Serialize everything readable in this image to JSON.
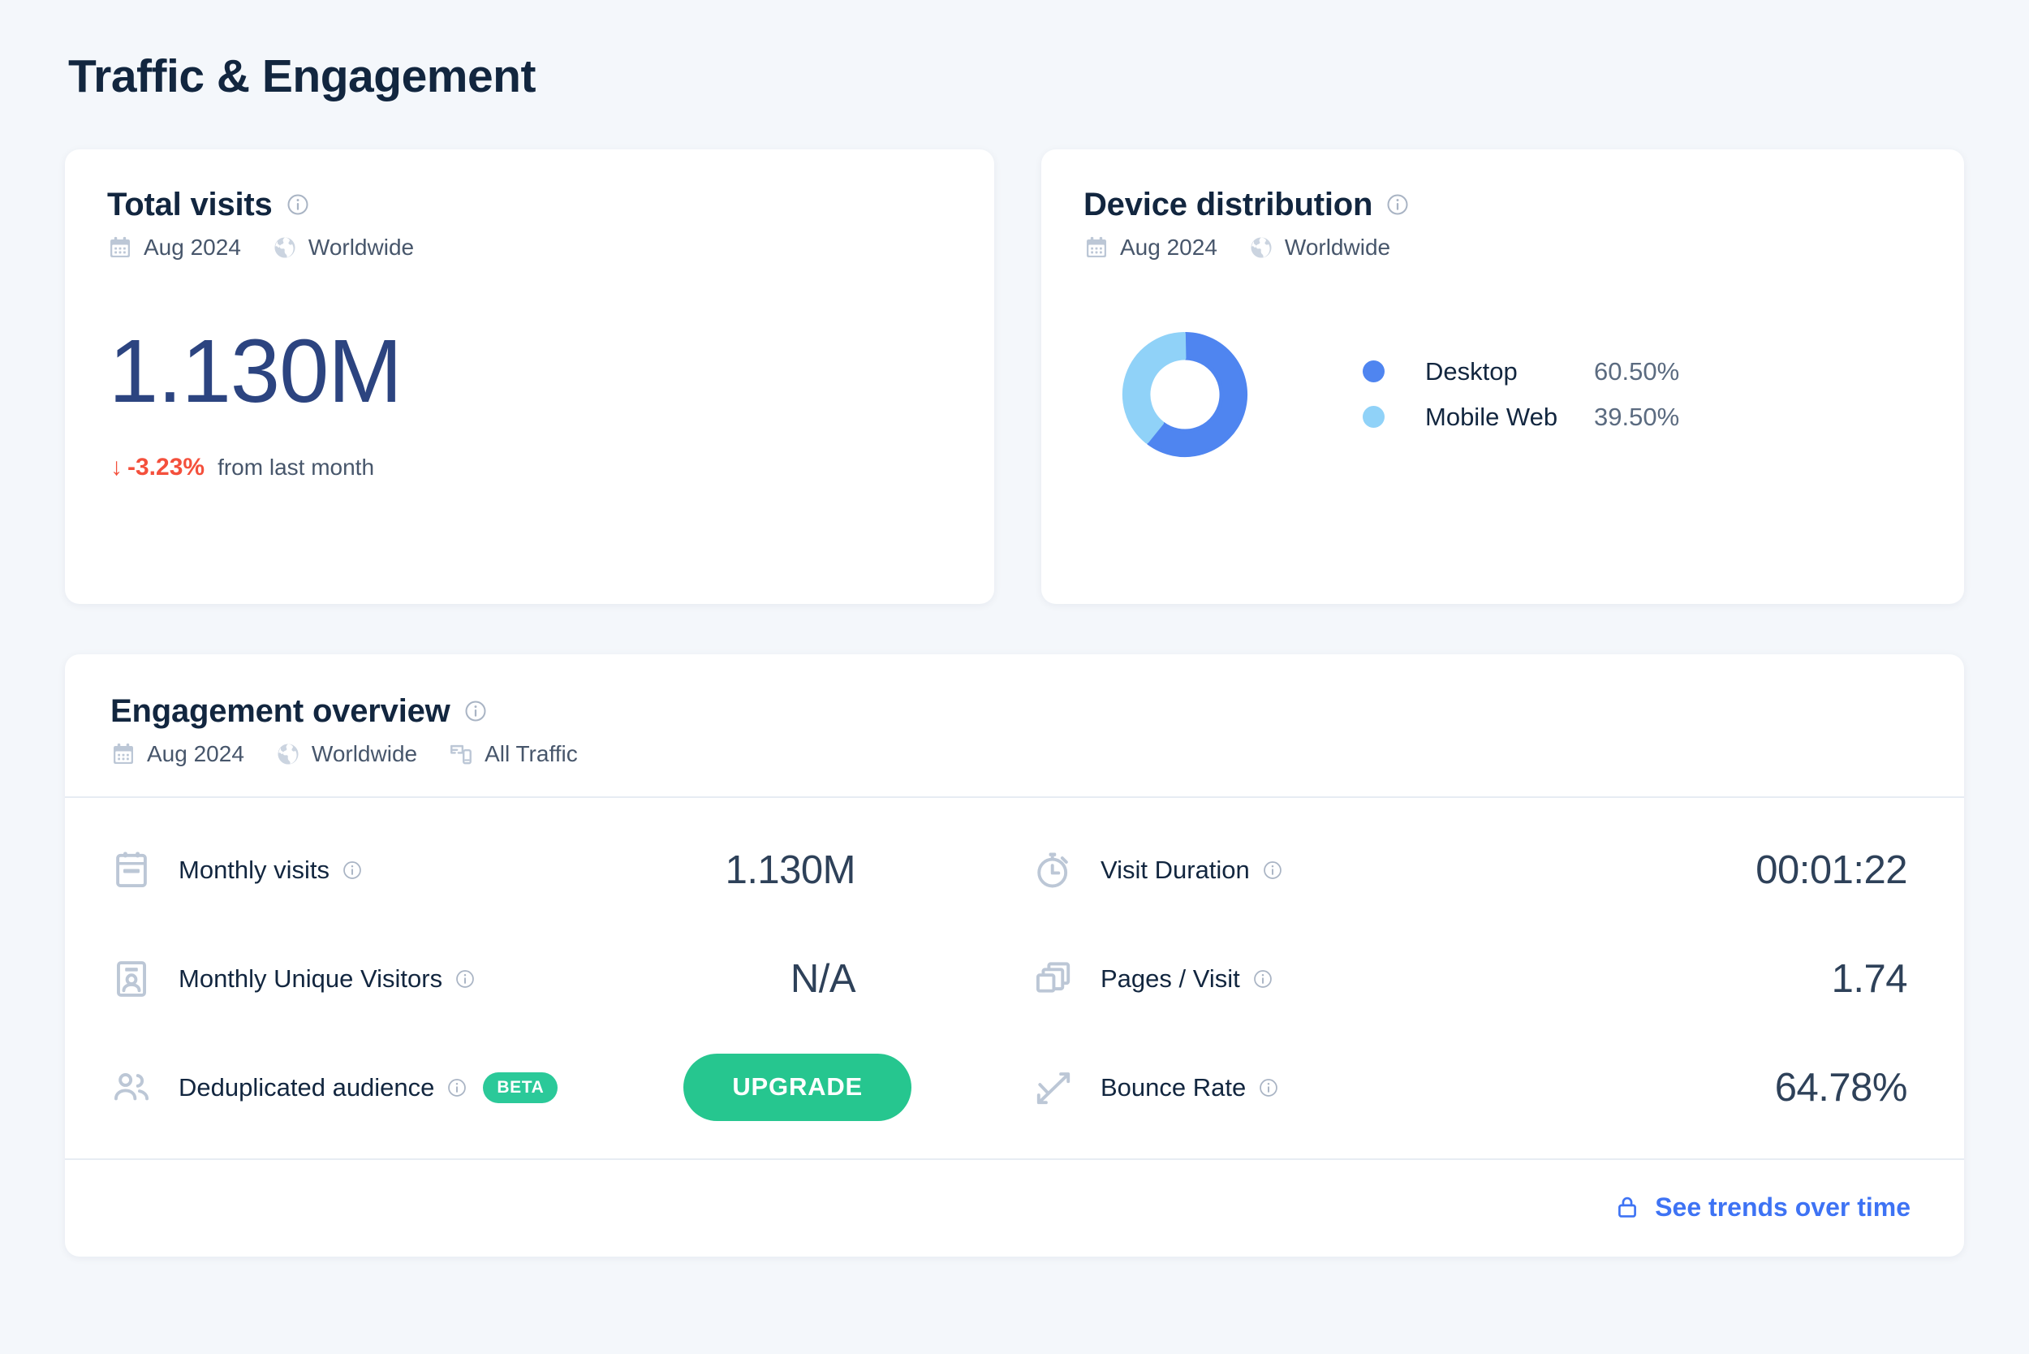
{
  "page": {
    "title": "Traffic & Engagement",
    "background_color": "#F4F7FB"
  },
  "total_visits_card": {
    "title": "Total visits",
    "info_icon": "info-icon",
    "meta": {
      "calendar_icon": "calendar-icon",
      "date": "Aug 2024",
      "globe_icon": "globe-icon",
      "region": "Worldwide"
    },
    "value": "1.130M",
    "delta": {
      "arrow": "↓",
      "percent": "-3.23%",
      "label": "from last month",
      "color": "#F4503C"
    }
  },
  "device_card": {
    "title": "Device distribution",
    "info_icon": "info-icon",
    "meta": {
      "calendar_icon": "calendar-icon",
      "date": "Aug 2024",
      "globe_icon": "globe-icon",
      "region": "Worldwide"
    },
    "legend": [
      {
        "label": "Desktop",
        "value": "60.50%",
        "color": "#4F85F0"
      },
      {
        "label": "Mobile Web",
        "value": "39.50%",
        "color": "#90D2F8"
      }
    ]
  },
  "chart_data": {
    "type": "pie",
    "title": "Device distribution",
    "subtitle": "Aug 2024 · Worldwide",
    "categories": [
      "Desktop",
      "Mobile Web"
    ],
    "values": [
      60.5,
      39.5
    ],
    "value_labels": [
      "60.50%",
      "39.50%"
    ],
    "colors": [
      "#4F85F0",
      "#90D2F8"
    ],
    "donut": true,
    "inner_radius_ratio": 0.6,
    "start_angle_deg": 0,
    "direction": "clockwise",
    "legend_position": "right",
    "units": "percent"
  },
  "engagement_card": {
    "title": "Engagement overview",
    "info_icon": "info-icon",
    "meta": {
      "calendar_icon": "calendar-icon",
      "date": "Aug 2024",
      "globe_icon": "globe-icon",
      "region": "Worldwide",
      "devices_icon": "devices-icon",
      "traffic": "All Traffic"
    },
    "metrics_left": [
      {
        "icon": "calendar-visits-icon",
        "label": "Monthly visits",
        "value": "1.130M"
      },
      {
        "icon": "id-badge-icon",
        "label": "Monthly Unique Visitors",
        "value": "N/A"
      },
      {
        "icon": "users-icon",
        "label": "Deduplicated audience",
        "badge": "BETA",
        "button": "UPGRADE"
      }
    ],
    "metrics_right": [
      {
        "icon": "stopwatch-icon",
        "label": "Visit Duration",
        "value": "00:01:22"
      },
      {
        "icon": "pages-icon",
        "label": "Pages / Visit",
        "value": "1.74"
      },
      {
        "icon": "trend-icon",
        "label": "Bounce Rate",
        "value": "64.78%"
      }
    ],
    "footer": {
      "lock_icon": "lock-icon",
      "link_label": "See trends over time",
      "link_color": "#3E73F4"
    }
  },
  "colors": {
    "accent_blue": "#3E73F4",
    "brand_green": "#26C68F",
    "negative_red": "#F4503C",
    "text_dark": "#12263F",
    "text_muted": "#47566B",
    "value_text": "#2E4159",
    "big_number": "#2C4480"
  }
}
